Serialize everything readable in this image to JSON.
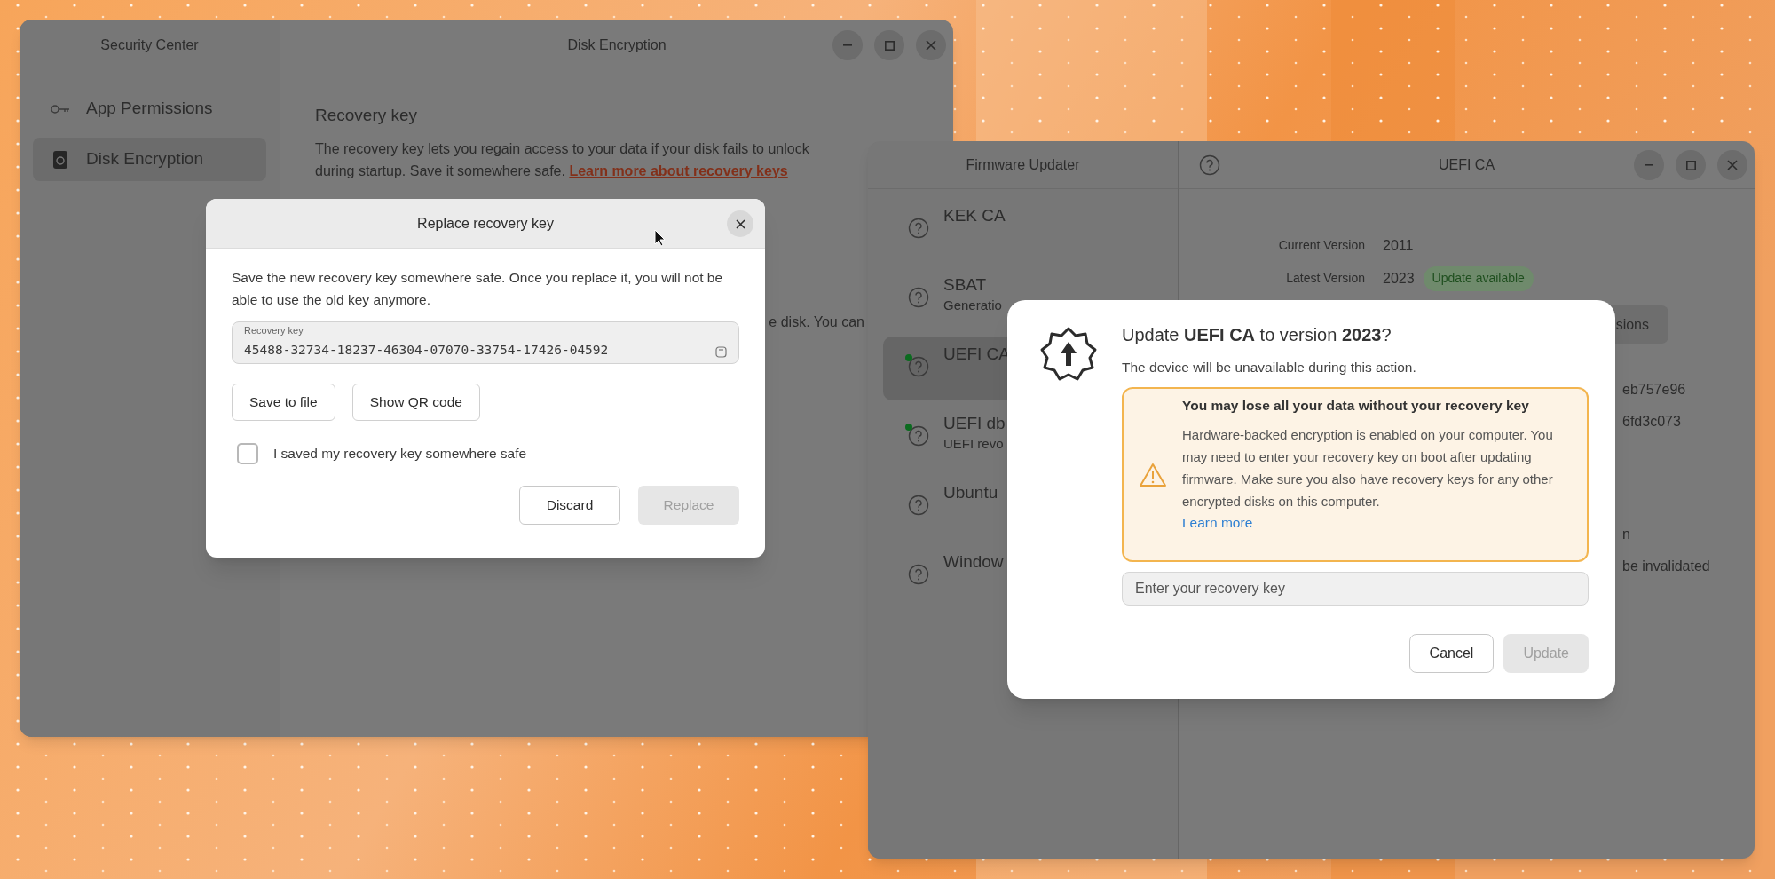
{
  "security_center": {
    "sidebar_title": "Security Center",
    "title": "Disk Encryption",
    "sidebar": [
      {
        "label": "App Permissions",
        "kind": "key",
        "selected": false
      },
      {
        "label": "Disk Encryption",
        "kind": "disk",
        "selected": true
      }
    ],
    "heading": "Recovery key",
    "description_line1": "The recovery key lets you regain access to your data if your disk fails to unlock",
    "description_line2": "during startup. Save it somewhere safe.",
    "link": "Learn more about recovery keys",
    "fragment": "e disk. You can"
  },
  "replace_dialog": {
    "title": "Replace recovery key",
    "message": "Save the new recovery key somewhere safe. Once you replace it, you will not be able to use the old key anymore.",
    "key_label": "Recovery key",
    "key_value": "45488-32734-18237-46304-07070-33754-17426-04592",
    "buttons": [
      "Save to file",
      "Show QR code"
    ],
    "checkbox": {
      "label": "I saved my recovery key somewhere safe",
      "checked": false
    },
    "actions": [
      {
        "label": "Discard",
        "disabled": false
      },
      {
        "label": "Replace",
        "disabled": true
      }
    ]
  },
  "firmware_updater": {
    "sidebar_title": "Firmware Updater",
    "title": "UEFI CA",
    "devices": [
      {
        "name": "KEK CA",
        "selected": false,
        "status_dot": false
      },
      {
        "name": "SBAT",
        "subtitle": "Generatio",
        "selected": false,
        "status_dot": false
      },
      {
        "name": "UEFI CA",
        "selected": true,
        "status_dot": true
      },
      {
        "name": "UEFI db",
        "subtitle": "UEFI revo",
        "selected": false,
        "status_dot": true
      },
      {
        "name": "Ubuntu",
        "selected": false,
        "status_dot": false
      },
      {
        "name": "Window",
        "selected": false,
        "status_dot": false
      }
    ],
    "details": [
      {
        "label": "Current Version",
        "value": "2011"
      },
      {
        "label": "Latest Version",
        "value": "2023",
        "badge": "Update available"
      }
    ],
    "button_fragment": "sions",
    "fragments": [
      "eb757e96",
      "6fd3c073",
      "n",
      "be invalidated"
    ]
  },
  "update_dialog": {
    "title": "Update **UEFI CA** to version **2023**?",
    "subtitle": "The device will be unavailable during this action.",
    "warning": {
      "title": "You may lose all your data without your recovery key",
      "body": "Hardware-backed encryption is enabled on your computer. You may need to enter your recovery key on boot after updating firmware. Make sure you also have recovery keys for any other encrypted disks on this computer.",
      "link": "Learn more"
    },
    "field": {
      "placeholder": "Enter your recovery key"
    },
    "actions": [
      {
        "label": "Cancel",
        "disabled": false
      },
      {
        "label": "Update",
        "disabled": true
      }
    ]
  }
}
